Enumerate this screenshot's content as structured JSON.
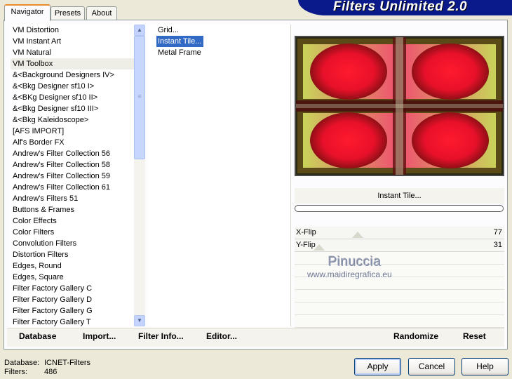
{
  "window": {
    "title": "Filters Unlimited 2.0"
  },
  "tabs": [
    {
      "label": "Navigator",
      "active": true
    },
    {
      "label": "Presets",
      "active": false
    },
    {
      "label": "About",
      "active": false
    }
  ],
  "categories": [
    "VM Distortion",
    "VM Instant Art",
    "VM Natural",
    "VM Toolbox",
    "&<Background Designers IV>",
    "&<Bkg Designer sf10 I>",
    "&<BKg Designer sf10 II>",
    "&<Bkg Designer sf10 III>",
    "&<Bkg Kaleidoscope>",
    "[AFS IMPORT]",
    "Alf's Border FX",
    "Andrew's Filter Collection 56",
    "Andrew's Filter Collection 58",
    "Andrew's Filter Collection 59",
    "Andrew's Filter Collection 61",
    "Andrew's Filters 51",
    "Buttons & Frames",
    "Color Effects",
    "Color Filters",
    "Convolution Filters",
    "Distortion Filters",
    "Edges, Round",
    "Edges, Square",
    "Filter Factory Gallery C",
    "Filter Factory Gallery D",
    "Filter Factory Gallery G",
    "Filter Factory Gallery T"
  ],
  "highlighted_category": "VM Toolbox",
  "filters": [
    "Grid...",
    "Instant Tile...",
    "Metal Frame"
  ],
  "selected_filter": "Instant Tile...",
  "preview": {
    "filter_name": "Instant Tile...",
    "progress": 0
  },
  "params": [
    {
      "label": "X-Flip",
      "value": "77"
    },
    {
      "label": "Y-Flip",
      "value": "31"
    }
  ],
  "watermark": {
    "name": "Pinuccia",
    "url": "www.maidiregrafica.eu"
  },
  "toolbar": {
    "database": "Database",
    "import": "Import...",
    "filter_info": "Filter Info...",
    "editor": "Editor...",
    "randomize": "Randomize",
    "reset": "Reset"
  },
  "status": {
    "database_label": "Database:",
    "database_value": "ICNET-Filters",
    "filters_label": "Filters:",
    "filters_value": "486"
  },
  "buttons": {
    "apply": "Apply",
    "cancel": "Cancel",
    "help": "Help"
  },
  "colors": {
    "selection": "#316ac5",
    "banner": "#0a1a8a",
    "tab_accent": "#e68b2c"
  }
}
